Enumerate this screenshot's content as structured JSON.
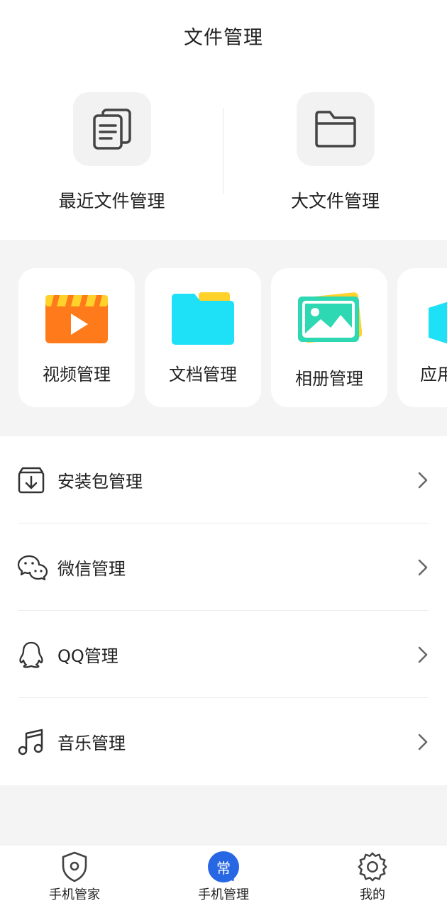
{
  "header": {
    "title": "文件管理"
  },
  "top_cards": [
    {
      "label": "最近文件管理",
      "icon": "documents-icon"
    },
    {
      "label": "大文件管理",
      "icon": "folder-outline-icon"
    }
  ],
  "categories": [
    {
      "label": "视频管理",
      "icon": "video-icon",
      "color": "#ff7a1a"
    },
    {
      "label": "文档管理",
      "icon": "document-folder-icon",
      "color": "#1ee1f7"
    },
    {
      "label": "相册管理",
      "icon": "photo-album-icon",
      "color": "#2dd8b2"
    },
    {
      "label": "应用",
      "icon": "app-box-icon",
      "color": "#1ee1f7"
    }
  ],
  "list": [
    {
      "label": "安装包管理",
      "icon": "package-download-icon"
    },
    {
      "label": "微信管理",
      "icon": "wechat-icon"
    },
    {
      "label": "QQ管理",
      "icon": "qq-icon"
    },
    {
      "label": "音乐管理",
      "icon": "music-note-icon"
    }
  ],
  "tabbar": {
    "tabs": [
      {
        "label": "手机管家",
        "icon": "shield-icon"
      },
      {
        "label": "手机管理",
        "icon": "active-badge-icon",
        "badge": "常",
        "active": true
      },
      {
        "label": "我的",
        "icon": "gear-icon"
      }
    ],
    "accent": "#2867e4"
  }
}
